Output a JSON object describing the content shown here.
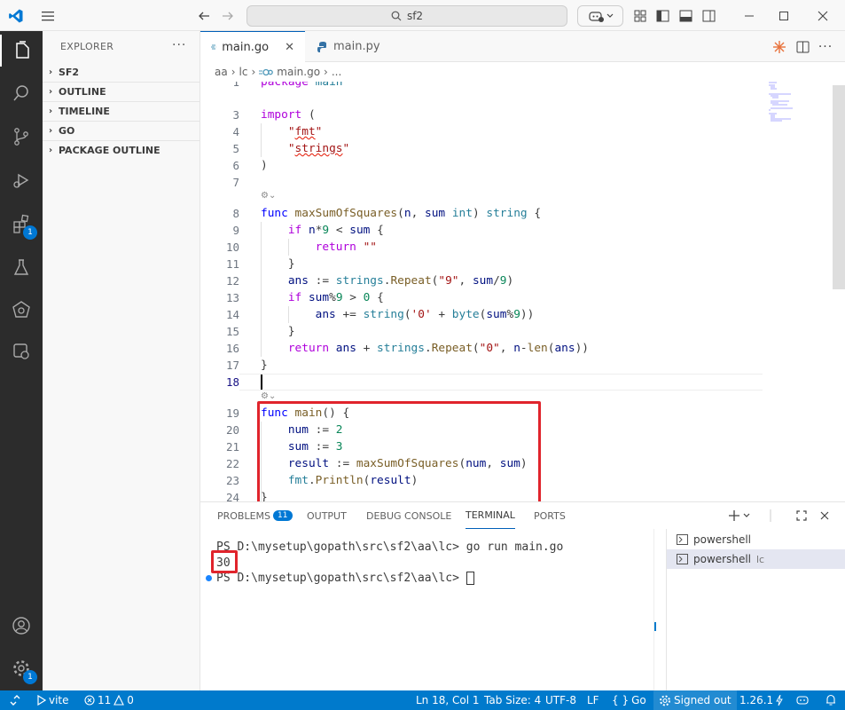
{
  "titlebar": {
    "search_text": "sf2"
  },
  "activity": {
    "extensions_badge": "1",
    "settings_badge": "1"
  },
  "sidebar": {
    "title": "EXPLORER",
    "sections": [
      "SF2",
      "OUTLINE",
      "TIMELINE",
      "GO",
      "PACKAGE OUTLINE"
    ]
  },
  "tabs": [
    {
      "label": "main.go",
      "active": true
    },
    {
      "label": "main.py",
      "active": false
    }
  ],
  "breadcrumb": [
    "aa",
    "lc",
    "main.go",
    "..."
  ],
  "editor": {
    "line_numbers": [
      "1",
      "3",
      "4",
      "5",
      "6",
      "7",
      "8",
      "9",
      "10",
      "11",
      "12",
      "13",
      "14",
      "15",
      "16",
      "17",
      "18",
      "19",
      "20",
      "21",
      "22",
      "23",
      "24"
    ],
    "current_line": "18"
  },
  "panel": {
    "tabs": [
      "PROBLEMS",
      "OUTPUT",
      "DEBUG CONSOLE",
      "TERMINAL",
      "PORTS"
    ],
    "problems_count": "11",
    "terminal_lines": [
      "PS D:\\mysetup\\gopath\\src\\sf2\\aa\\lc> go run main.go",
      "30",
      "PS D:\\mysetup\\gopath\\src\\sf2\\aa\\lc> "
    ],
    "prompt": "PS D:\\mysetup\\gopath\\src\\sf2\\aa\\lc> ",
    "command": "go run main.go",
    "output": "30",
    "terminals": [
      {
        "name": "powershell",
        "suffix": ""
      },
      {
        "name": "powershell",
        "suffix": "lc"
      }
    ]
  },
  "statusbar": {
    "vite": "vite",
    "errors": "11",
    "warnings": "0",
    "position": "Ln 18, Col 1",
    "tab_size": "Tab Size: 4",
    "encoding": "UTF-8",
    "eol": "LF",
    "language": "Go",
    "signed": "Signed out",
    "version": "1.26.1"
  },
  "colors": {
    "accent": "#007acc",
    "highlight_box": "#e0242c",
    "activity_bg": "#2c2c2c"
  }
}
